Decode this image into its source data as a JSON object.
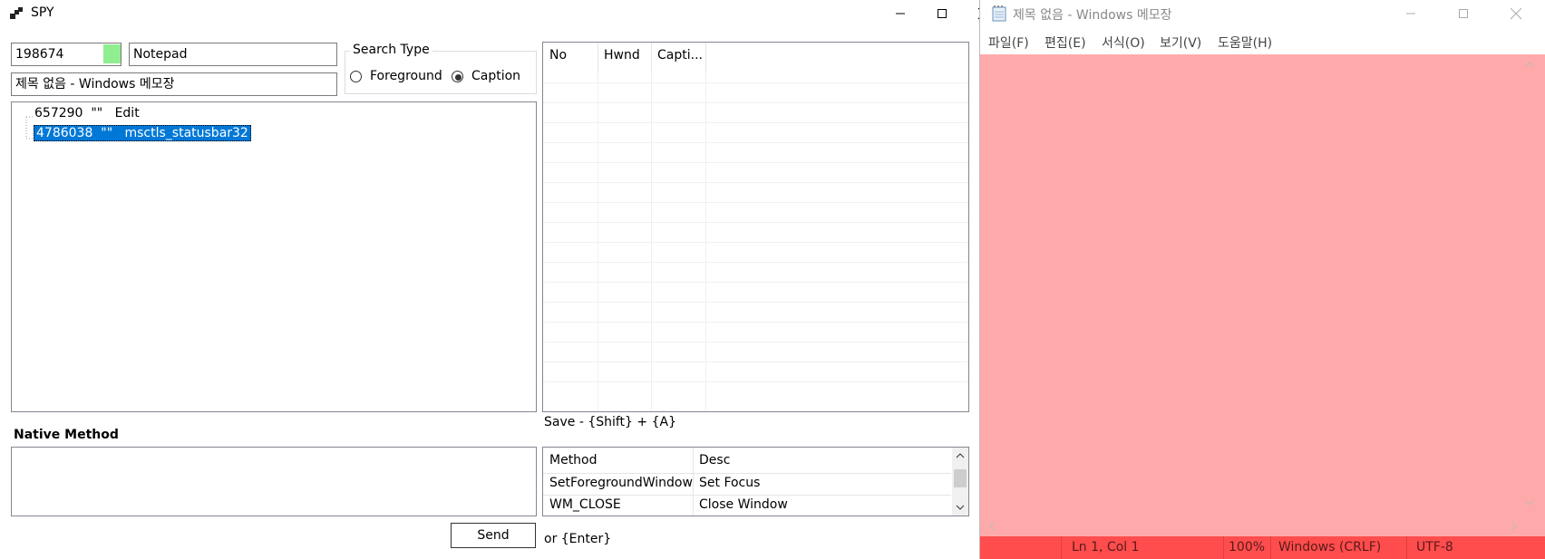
{
  "spy": {
    "title": "SPY",
    "hwnd_value": "198674",
    "hwnd_color": "#90ee90",
    "class_value": "Notepad",
    "caption_value": "제목 없음 - Windows 메모장",
    "search_type": {
      "legend": "Search Type",
      "options": [
        {
          "label": "Foreground",
          "selected": false
        },
        {
          "label": "Caption",
          "selected": true
        }
      ]
    },
    "tree": [
      {
        "text": "657290  \"\"   Edit",
        "selected": false
      },
      {
        "text": "4786038  \"\"   msctls_statusbar32",
        "selected": true
      }
    ],
    "list_columns": [
      "No",
      "Hwnd",
      "Capti..."
    ],
    "save_hint": "Save - {Shift} + {A}",
    "native_method_label": "Native Method",
    "method_columns": [
      "Method",
      "Desc"
    ],
    "methods": [
      {
        "method": "SetForegroundWindow",
        "desc": "Set Focus"
      },
      {
        "method": "WM_CLOSE",
        "desc": "Close Window"
      }
    ],
    "send_label": "Send",
    "enter_hint": "or {Enter}",
    "selection_color": "#0078d7"
  },
  "notepad": {
    "title": "제목 없음 - Windows 메모장",
    "menu": [
      "파일(F)",
      "편집(E)",
      "서식(O)",
      "보기(V)",
      "도움말(H)"
    ],
    "status": {
      "position": "Ln 1, Col 1",
      "zoom": "100%",
      "line_ending": "Windows (CRLF)",
      "encoding": "UTF-8"
    },
    "overlay_color": "#ffaaaa",
    "status_color": "#ff4c4c"
  }
}
